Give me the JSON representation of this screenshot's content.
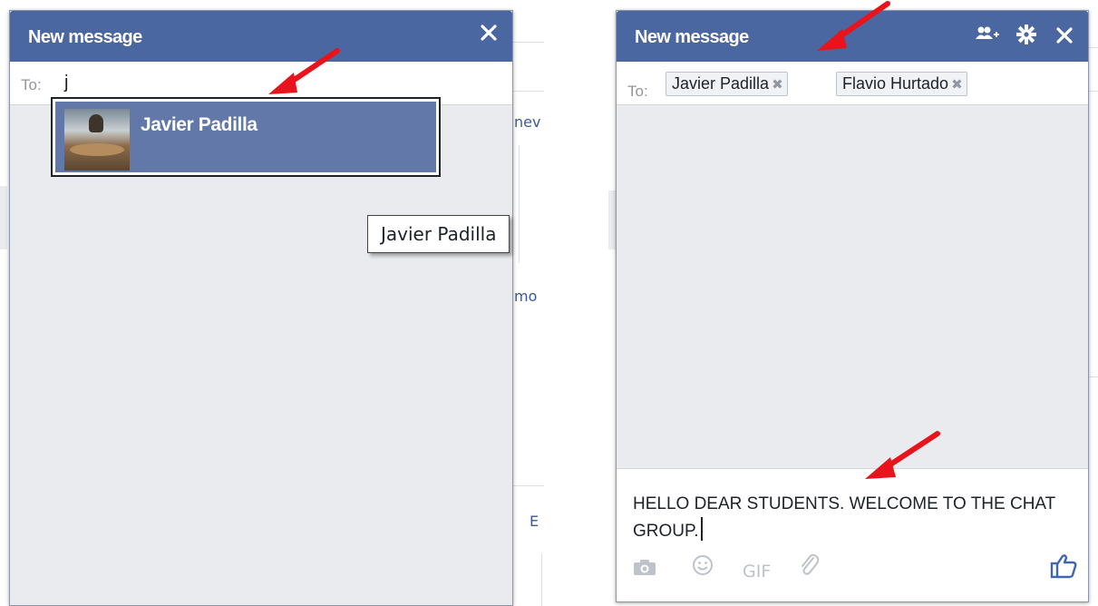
{
  "left_window": {
    "title": "New message",
    "to_label": "To:",
    "to_value": "j",
    "suggestion_name": "Javier Padilla",
    "tooltip": "Javier Padilla"
  },
  "right_window": {
    "title": "New message",
    "to_label": "To:",
    "recipients": [
      "Javier Padilla",
      "Flavio Hurtado"
    ],
    "message_text": "HELLO DEAR STUDENTS. WELCOME TO THE CHAT GROUP.",
    "toolbar": {
      "camera_icon": "camera-icon",
      "emoji_icon": "emoji-icon",
      "gif_label": "GIF",
      "attach_icon": "paperclip-icon",
      "like_icon": "thumbs-up-icon"
    }
  },
  "background": {
    "fragments": [
      "nev",
      "mo",
      "E"
    ]
  },
  "colors": {
    "header": "#4b67a1",
    "suggestion_bg": "#6178a8",
    "arrow": "#e8131b",
    "like": "#4267b2"
  }
}
